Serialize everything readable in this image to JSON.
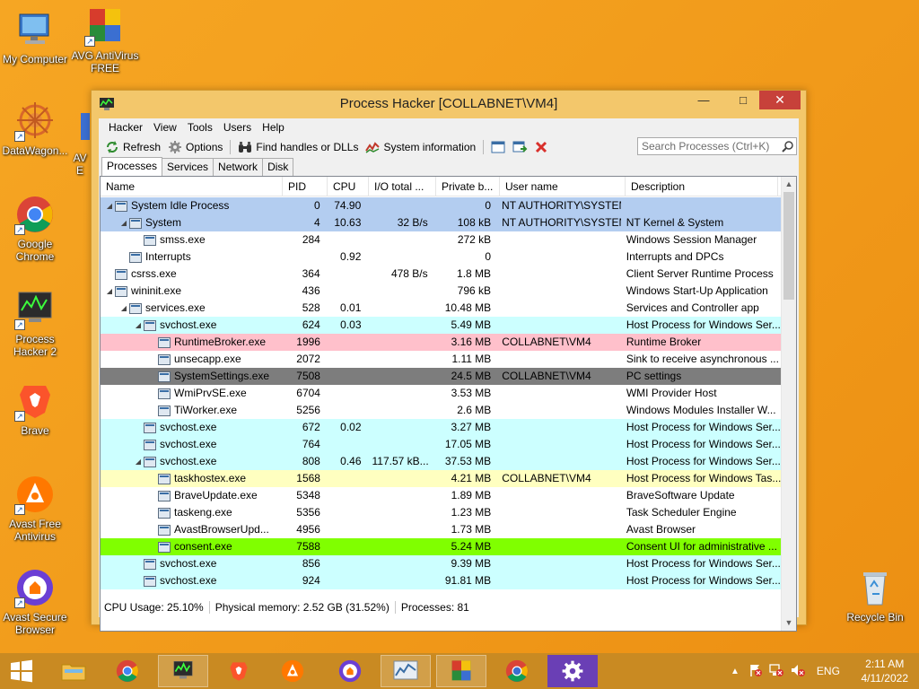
{
  "desktop": {
    "icons": [
      {
        "label": "My Computer"
      },
      {
        "label": "AVG AntiVirus FREE"
      },
      {
        "label": "DataWagon..."
      },
      {
        "label": "AV E"
      },
      {
        "label": "Google Chrome"
      },
      {
        "label": "Process Hacker 2"
      },
      {
        "label": "Brave"
      },
      {
        "label": "Avast Free Antivirus"
      },
      {
        "label": "Avast Secure Browser"
      },
      {
        "label": "Recycle Bin"
      }
    ]
  },
  "window": {
    "title": "Process Hacker [COLLABNET\\VM4]",
    "menu": [
      "Hacker",
      "View",
      "Tools",
      "Users",
      "Help"
    ],
    "toolbar": {
      "refresh": "Refresh",
      "options": "Options",
      "find_handles": "Find handles or DLLs",
      "system_info": "System information"
    },
    "search_placeholder": "Search Processes (Ctrl+K)",
    "tabs": [
      "Processes",
      "Services",
      "Network",
      "Disk"
    ],
    "columns": [
      "Name",
      "PID",
      "CPU",
      "I/O total ...",
      "Private b...",
      "User name",
      "Description"
    ],
    "rows": [
      {
        "name": "System Idle Process",
        "pid": "0",
        "cpu": "74.90",
        "io": "",
        "priv": "0",
        "user": "NT AUTHORITY\\SYSTEM",
        "desc": "",
        "level": 0,
        "exp": "◢",
        "color": "#b3cdf0"
      },
      {
        "name": "System",
        "pid": "4",
        "cpu": "10.63",
        "io": "32 B/s",
        "priv": "108 kB",
        "user": "NT AUTHORITY\\SYSTEM",
        "desc": "NT Kernel & System",
        "level": 1,
        "exp": "◢",
        "color": "#b3cdf0"
      },
      {
        "name": "smss.exe",
        "pid": "284",
        "cpu": "",
        "io": "",
        "priv": "272 kB",
        "user": "",
        "desc": "Windows Session Manager",
        "level": 2,
        "exp": "",
        "color": "#ffffff"
      },
      {
        "name": "Interrupts",
        "pid": "",
        "cpu": "0.92",
        "io": "",
        "priv": "0",
        "user": "",
        "desc": "Interrupts and DPCs",
        "level": 1,
        "exp": "",
        "color": "#ffffff"
      },
      {
        "name": "csrss.exe",
        "pid": "364",
        "cpu": "",
        "io": "478 B/s",
        "priv": "1.8 MB",
        "user": "",
        "desc": "Client Server Runtime Process",
        "level": 0,
        "exp": "",
        "color": "#ffffff"
      },
      {
        "name": "wininit.exe",
        "pid": "436",
        "cpu": "",
        "io": "",
        "priv": "796 kB",
        "user": "",
        "desc": "Windows Start-Up Application",
        "level": 0,
        "exp": "◢",
        "color": "#ffffff"
      },
      {
        "name": "services.exe",
        "pid": "528",
        "cpu": "0.01",
        "io": "",
        "priv": "10.48 MB",
        "user": "",
        "desc": "Services and Controller app",
        "level": 1,
        "exp": "◢",
        "color": "#ffffff"
      },
      {
        "name": "svchost.exe",
        "pid": "624",
        "cpu": "0.03",
        "io": "",
        "priv": "5.49 MB",
        "user": "",
        "desc": "Host Process for Windows Ser...",
        "level": 2,
        "exp": "◢",
        "color": "#ccffff"
      },
      {
        "name": "RuntimeBroker.exe",
        "pid": "1996",
        "cpu": "",
        "io": "",
        "priv": "3.16 MB",
        "user": "COLLABNET\\VM4",
        "desc": "Runtime Broker",
        "level": 3,
        "exp": "",
        "color": "#ffc0cb"
      },
      {
        "name": "unsecapp.exe",
        "pid": "2072",
        "cpu": "",
        "io": "",
        "priv": "1.11 MB",
        "user": "",
        "desc": "Sink to receive asynchronous ...",
        "level": 3,
        "exp": "",
        "color": "#ffffff"
      },
      {
        "name": "SystemSettings.exe",
        "pid": "7508",
        "cpu": "",
        "io": "",
        "priv": "24.5 MB",
        "user": "COLLABNET\\VM4",
        "desc": "PC settings",
        "level": 3,
        "exp": "",
        "color": "#7d7d7d"
      },
      {
        "name": "WmiPrvSE.exe",
        "pid": "6704",
        "cpu": "",
        "io": "",
        "priv": "3.53 MB",
        "user": "",
        "desc": "WMI Provider Host",
        "level": 3,
        "exp": "",
        "color": "#ffffff"
      },
      {
        "name": "TiWorker.exe",
        "pid": "5256",
        "cpu": "",
        "io": "",
        "priv": "2.6 MB",
        "user": "",
        "desc": "Windows Modules Installer W...",
        "level": 3,
        "exp": "",
        "color": "#ffffff"
      },
      {
        "name": "svchost.exe",
        "pid": "672",
        "cpu": "0.02",
        "io": "",
        "priv": "3.27 MB",
        "user": "",
        "desc": "Host Process for Windows Ser...",
        "level": 2,
        "exp": "",
        "color": "#ccffff"
      },
      {
        "name": "svchost.exe",
        "pid": "764",
        "cpu": "",
        "io": "",
        "priv": "17.05 MB",
        "user": "",
        "desc": "Host Process for Windows Ser...",
        "level": 2,
        "exp": "",
        "color": "#ccffff"
      },
      {
        "name": "svchost.exe",
        "pid": "808",
        "cpu": "0.46",
        "io": "117.57 kB...",
        "priv": "37.53 MB",
        "user": "",
        "desc": "Host Process for Windows Ser...",
        "level": 2,
        "exp": "◢",
        "color": "#ccffff"
      },
      {
        "name": "taskhostex.exe",
        "pid": "1568",
        "cpu": "",
        "io": "",
        "priv": "4.21 MB",
        "user": "COLLABNET\\VM4",
        "desc": "Host Process for Windows Tas...",
        "level": 3,
        "exp": "",
        "color": "#ffffc0"
      },
      {
        "name": "BraveUpdate.exe",
        "pid": "5348",
        "cpu": "",
        "io": "",
        "priv": "1.89 MB",
        "user": "",
        "desc": "BraveSoftware Update",
        "level": 3,
        "exp": "",
        "color": "#ffffff"
      },
      {
        "name": "taskeng.exe",
        "pid": "5356",
        "cpu": "",
        "io": "",
        "priv": "1.23 MB",
        "user": "",
        "desc": "Task Scheduler Engine",
        "level": 3,
        "exp": "",
        "color": "#ffffff"
      },
      {
        "name": "AvastBrowserUpd...",
        "pid": "4956",
        "cpu": "",
        "io": "",
        "priv": "1.73 MB",
        "user": "",
        "desc": "Avast Browser",
        "level": 3,
        "exp": "",
        "color": "#ffffff"
      },
      {
        "name": "consent.exe",
        "pid": "7588",
        "cpu": "",
        "io": "",
        "priv": "5.24 MB",
        "user": "",
        "desc": "Consent UI for administrative ...",
        "level": 3,
        "exp": "",
        "color": "#80ff00"
      },
      {
        "name": "svchost.exe",
        "pid": "856",
        "cpu": "",
        "io": "",
        "priv": "9.39 MB",
        "user": "",
        "desc": "Host Process for Windows Ser...",
        "level": 2,
        "exp": "",
        "color": "#ccffff"
      },
      {
        "name": "svchost.exe",
        "pid": "924",
        "cpu": "",
        "io": "",
        "priv": "91.81 MB",
        "user": "",
        "desc": "Host Process for Windows Ser...",
        "level": 2,
        "exp": "",
        "color": "#ccffff"
      }
    ],
    "status": {
      "cpu": "CPU Usage: 25.10%",
      "memory": "Physical memory: 2.52 GB (31.52%)",
      "processes": "Processes: 81"
    }
  },
  "taskbar": {
    "language": "ENG",
    "time": "2:11 AM",
    "date": "4/11/2022"
  }
}
